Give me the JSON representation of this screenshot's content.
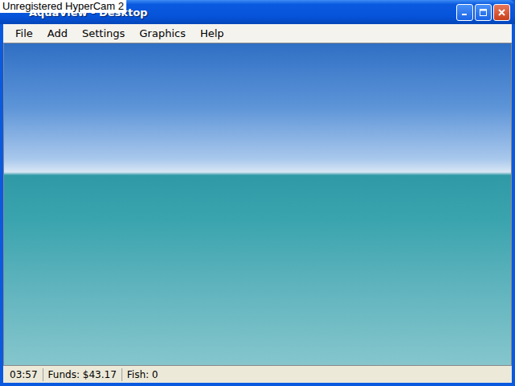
{
  "window": {
    "title": "AquaView - Desktop"
  },
  "watermark": {
    "text": "Unregistered HyperCam 2"
  },
  "menu": [
    {
      "label": "File"
    },
    {
      "label": "Add"
    },
    {
      "label": "Settings"
    },
    {
      "label": "Graphics"
    },
    {
      "label": "Help"
    }
  ],
  "status_bar": [
    {
      "text": "03:57"
    },
    {
      "text": "Funds: $43.17"
    },
    {
      "text": "Fish: 0"
    }
  ]
}
